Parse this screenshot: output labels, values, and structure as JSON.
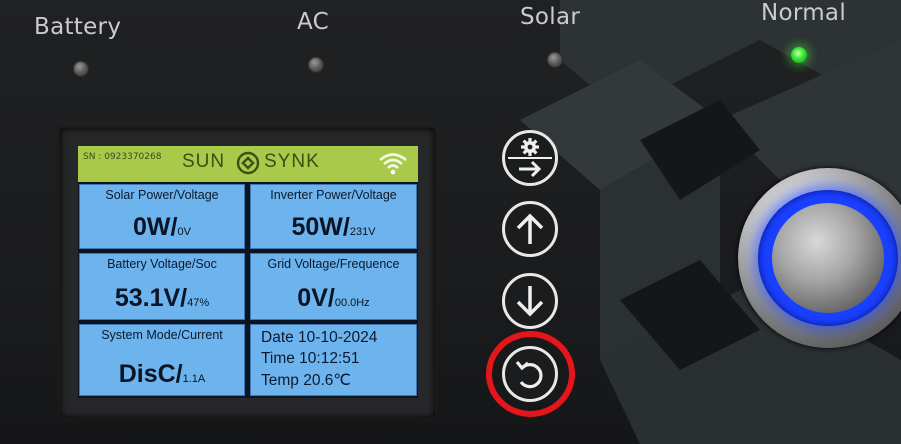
{
  "indicators": {
    "battery": "Battery",
    "ac": "AC",
    "solar": "Solar",
    "normal": "Normal"
  },
  "screen": {
    "serial": "SN : 0923370268",
    "brand_left": "SUN",
    "brand_right": "SYNK",
    "tiles": {
      "solar_label": "Solar Power/Voltage",
      "solar_main": "0W/",
      "solar_sub": "0V",
      "inverter_label": "Inverter Power/Voltage",
      "inverter_main": "50W/",
      "inverter_sub": "231V",
      "battery_label": "Battery Voltage/Soc",
      "battery_main": "53.1V/",
      "battery_sub": "47%",
      "grid_label": "Grid Voltage/Frequence",
      "grid_main": "0V/",
      "grid_sub": "00.0Hz",
      "mode_label": "System Mode/Current",
      "mode_main": "DisC/",
      "mode_sub": "1.1A"
    },
    "info": {
      "date": "Date 10-10-2024",
      "time": "Time 10:12:51",
      "temp": "Temp 20.6℃"
    }
  },
  "buttons": [
    "settings-enter",
    "up",
    "down",
    "back"
  ],
  "colors": {
    "lcd_topbar": "#a9c94a",
    "lcd_tile": "#6db3ee",
    "highlight": "#e4161c",
    "power_ring": "#1a40ff",
    "status_led": "#3ee83a"
  }
}
